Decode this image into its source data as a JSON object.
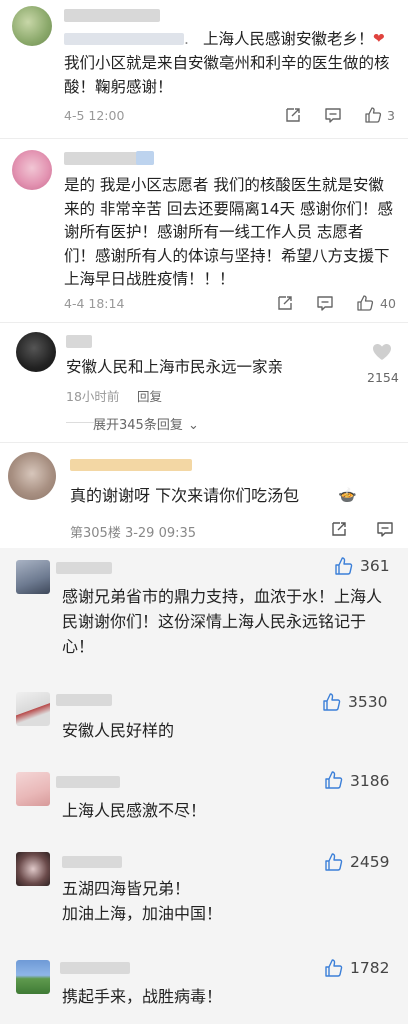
{
  "comments": [
    {
      "mention_suffix": ".",
      "text_line1": "上海人民感谢安徽老乡！",
      "heart": "❤",
      "text_rest": "我们小区就是来自安徽亳州和利辛的医生做的核酸！鞠躬感谢！",
      "time": "4-5 12:00",
      "likes": "3"
    },
    {
      "text": "是的 我是小区志愿者 我们的核酸医生就是安徽来的 非常辛苦 回去还要隔离14天 感谢你们！感谢所有医护！感谢所有一线工作人员 志愿者们！感谢所有人的体谅与坚持！希望八方支援下 上海早日战胜疫情！！！",
      "time": "4-4 18:14",
      "likes": "40"
    },
    {
      "text": "安徽人民和上海市民永远一家亲",
      "time": "18小时前",
      "reply_label": "回复",
      "likes": "2154",
      "expand_label": "展开345条回复"
    },
    {
      "text": "真的谢谢呀 下次来请你们吃汤包",
      "emoji": "🍲",
      "floor_time": "第305楼  3-29 09:35"
    }
  ],
  "section2": [
    {
      "text": "感谢兄弟省市的鼎力支持，血浓于水！上海人民谢谢你们！这份深情上海人民永远铭记于心！",
      "likes": "361"
    },
    {
      "text": "安徽人民好样的",
      "likes": "3530"
    },
    {
      "text": "上海人民感激不尽！",
      "likes": "3186"
    },
    {
      "text": "五湖四海皆兄弟！\n加油上海，加油中国！",
      "likes": "2459"
    },
    {
      "text": "携起手来，战胜病毒！",
      "likes": "1782"
    }
  ],
  "colors": {
    "accent_heart": "#e0433e",
    "link_blue": "#4a7fd6",
    "gray_bg": "#f4f4f4"
  }
}
